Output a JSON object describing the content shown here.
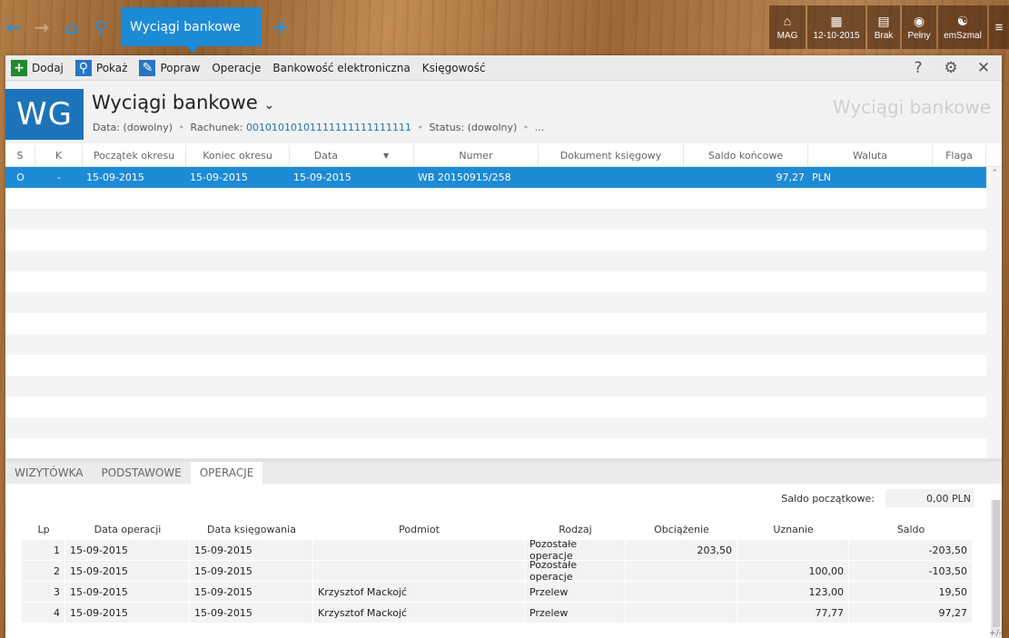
{
  "nav": {
    "back_icon": "back-arrow-icon",
    "forward_icon": "forward-arrow-icon",
    "home_icon": "home-icon",
    "search_icon": "search-icon",
    "active_tab": "Wyciągi bankowe",
    "add_tab_icon": "plus-icon"
  },
  "tiles": [
    {
      "label": "MAG",
      "icon": "warehouse-icon"
    },
    {
      "label": "12-10-2015",
      "icon": "calendar-icon"
    },
    {
      "label": "Brak",
      "icon": "document-icon"
    },
    {
      "label": "Pełny",
      "icon": "circles-icon"
    },
    {
      "label": "emSzmal",
      "icon": "network-icon"
    }
  ],
  "toolbar": {
    "add": "Dodaj",
    "show": "Pokaż",
    "edit": "Popraw",
    "operations": "Operacje",
    "ebanking": "Bankowość elektroniczna",
    "accounting": "Księgowość"
  },
  "header": {
    "logo": "WG",
    "title": "Wyciągi bankowe",
    "filter_data_label": "Data:",
    "filter_data_value": "(dowolny)",
    "filter_account_label": "Rachunek:",
    "filter_account_value": "00101010101111111111111111",
    "filter_status_label": "Status:",
    "filter_status_value": "(dowolny)",
    "filter_more": "...",
    "watermark": "Wyciągi bankowe"
  },
  "grid": {
    "columns": [
      "S",
      "K",
      "Początek okresu",
      "Koniec okresu",
      "Data",
      "Numer",
      "Dokument księgowy",
      "Saldo końcowe",
      "Waluta",
      "Flaga"
    ],
    "rows": [
      {
        "s": "O",
        "k": "-",
        "start": "15-09-2015",
        "end": "15-09-2015",
        "date": "15-09-2015",
        "number": "WB 20150915/258",
        "doc": "",
        "balance": "97,27",
        "currency": "PLN",
        "flag": ""
      }
    ]
  },
  "tabs": [
    "WIZYTÓWKA",
    "PODSTAWOWE",
    "OPERACJE"
  ],
  "operations": {
    "opening_balance_label": "Saldo początkowe:",
    "opening_balance_value": "0,00 PLN",
    "columns": [
      "Lp",
      "Data operacji",
      "Data księgowania",
      "Podmiot",
      "Rodzaj",
      "Obciążenie",
      "Uznanie",
      "Saldo"
    ],
    "rows": [
      {
        "lp": "1",
        "op_date": "15-09-2015",
        "book_date": "15-09-2015",
        "entity": "",
        "type": "Pozostałe operacje",
        "debit": "203,50",
        "credit": "",
        "balance": "-203,50"
      },
      {
        "lp": "2",
        "op_date": "15-09-2015",
        "book_date": "15-09-2015",
        "entity": "",
        "type": "Pozostałe operacje",
        "debit": "",
        "credit": "100,00",
        "balance": "-103,50"
      },
      {
        "lp": "3",
        "op_date": "15-09-2015",
        "book_date": "15-09-2015",
        "entity": "Krzysztof Mackojć",
        "type": "Przelew",
        "debit": "",
        "credit": "123,00",
        "balance": "19,50"
      },
      {
        "lp": "4",
        "op_date": "15-09-2015",
        "book_date": "15-09-2015",
        "entity": "Krzysztof Mackojć",
        "type": "Przelew",
        "debit": "",
        "credit": "77,77",
        "balance": "97,27"
      }
    ],
    "plus_minus": "+/-"
  },
  "colors": {
    "accent": "#1d8ad6",
    "logo_bg": "#1d73b9",
    "add_green": "#1e8a2e"
  }
}
